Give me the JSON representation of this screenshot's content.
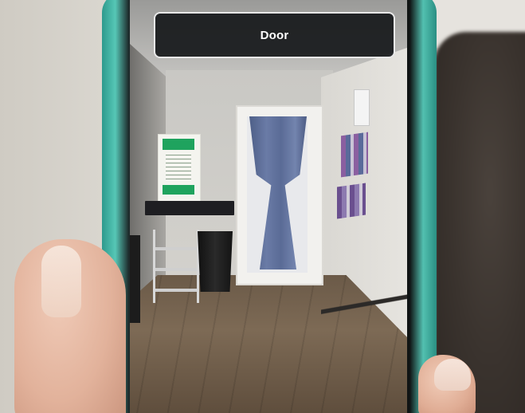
{
  "overlay": {
    "label": "Door"
  }
}
